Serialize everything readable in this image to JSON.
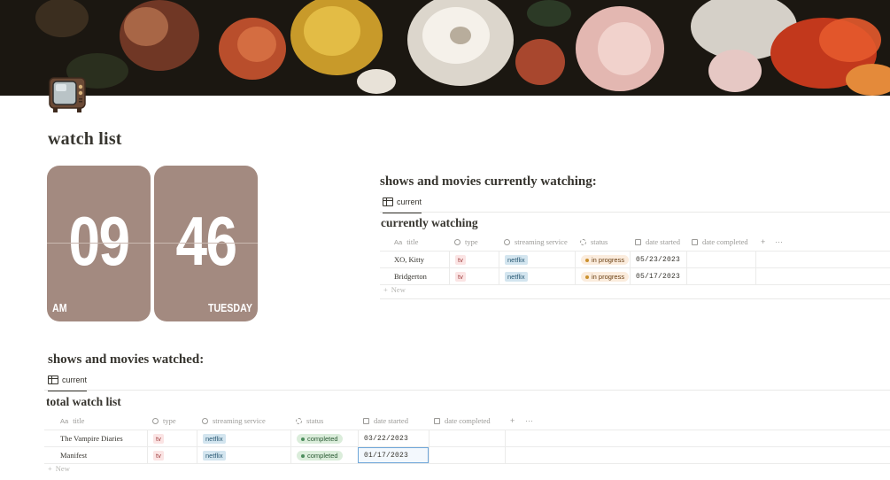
{
  "page": {
    "title": "watch list"
  },
  "clock": {
    "hour": "09",
    "minute": "46",
    "meridiem": "AM",
    "weekday": "TUESDAY"
  },
  "current_section": {
    "heading": "shows and movies currently watching:",
    "view_tab": "current",
    "database_title": "currently watching",
    "columns": [
      "title",
      "type",
      "streaming service",
      "status",
      "date started",
      "date completed"
    ],
    "rows": [
      {
        "title": "XO, Kitty",
        "type": "tv",
        "service": "netflix",
        "status": "in progress",
        "date_started": "05/23/2023",
        "date_completed": ""
      },
      {
        "title": "Bridgerton",
        "type": "tv",
        "service": "netflix",
        "status": "in progress",
        "date_started": "05/17/2023",
        "date_completed": ""
      }
    ],
    "new_label": "New",
    "add_column": "+",
    "more": "···"
  },
  "watched_section": {
    "heading": "shows and movies watched:",
    "view_tab": "current",
    "database_title": "total watch list",
    "columns": [
      "title",
      "type",
      "streaming service",
      "status",
      "date started",
      "date completed"
    ],
    "rows": [
      {
        "title": "The Vampire Diaries",
        "type": "tv",
        "service": "netflix",
        "status": "completed",
        "date_started": "03/22/2023",
        "date_completed": ""
      },
      {
        "title": "Manifest",
        "type": "tv",
        "service": "netflix",
        "status": "completed",
        "date_started": "01/17/2023",
        "date_completed": ""
      }
    ],
    "new_label": "New",
    "add_column": "+",
    "more": "···"
  },
  "colors": {
    "clock_card": "#a38a80",
    "tag_tv": "#fbe4e4",
    "tag_netflix": "#d3e5ef",
    "status_in_progress": "#fbecdd",
    "status_completed": "#dbeddb"
  },
  "icons": {
    "page_icon": "television-icon",
    "view_icon": "table-icon",
    "title_prop": "text-property-icon",
    "type_prop": "select-property-icon",
    "service_prop": "select-property-icon",
    "status_prop": "status-property-icon",
    "date_prop": "calendar-icon"
  }
}
